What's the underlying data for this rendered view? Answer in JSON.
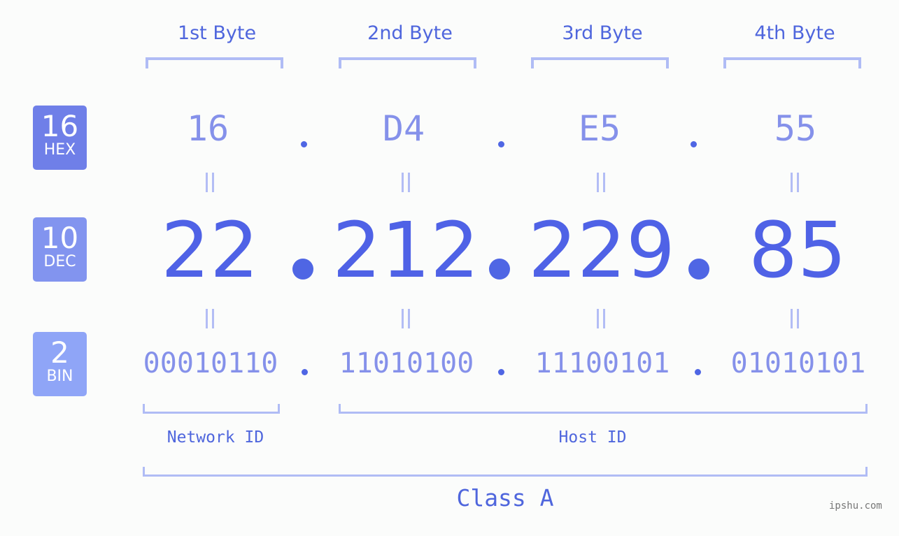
{
  "badges": [
    {
      "number": "16",
      "label": "HEX",
      "color": "#6f7fe8"
    },
    {
      "number": "10",
      "label": "DEC",
      "color": "#8294ef"
    },
    {
      "number": "2",
      "label": "BIN",
      "color": "#8fa5f7"
    }
  ],
  "bytes": [
    {
      "label": "1st Byte",
      "hex": "16",
      "dec": "22",
      "bin": "00010110"
    },
    {
      "label": "2nd Byte",
      "hex": "D4",
      "dec": "212",
      "bin": "11010100"
    },
    {
      "label": "3rd Byte",
      "hex": "E5",
      "dec": "229",
      "bin": "11100101"
    },
    {
      "label": "4th Byte",
      "hex": "55",
      "dec": "85",
      "bin": "01010101"
    }
  ],
  "network_id_label": "Network ID",
  "host_id_label": "Host ID",
  "class_label": "Class A",
  "watermark": "ipshu.com"
}
